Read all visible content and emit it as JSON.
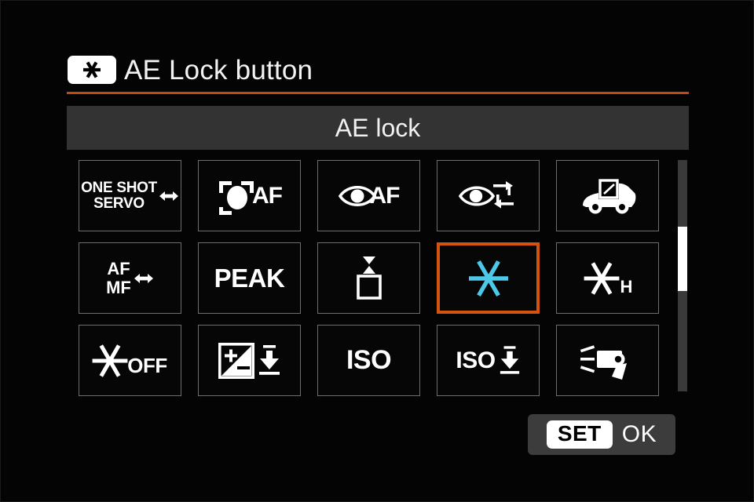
{
  "header": {
    "badge_icon": "ae-lock-asterisk-icon",
    "title": "AE Lock button"
  },
  "title_bar": {
    "current_function": "AE lock"
  },
  "grid": {
    "rows": 3,
    "columns": 5,
    "selected_index": 8,
    "selected_color": "#d4530f",
    "selected_icon_color": "#4dc8e8",
    "tiles": [
      {
        "name": "af-operation",
        "icon": "one-shot-servo-icon",
        "line1": "ONE SHOT",
        "line2": "SERVO",
        "selected": false
      },
      {
        "name": "subject-tracking-af",
        "icon": "subject-detect-af-icon",
        "label": "AF",
        "selected": false
      },
      {
        "name": "eye-detection-af",
        "icon": "eye-detect-af-icon",
        "label": "AF",
        "selected": false
      },
      {
        "name": "eye-detection-switch",
        "icon": "eye-switch-cycle-icon",
        "selected": false
      },
      {
        "name": "subject-to-detect-vehicle",
        "icon": "vehicle-detect-icon",
        "selected": false
      },
      {
        "name": "af-mf-switch",
        "icon": "af-mf-switch-icon",
        "line1": "AF",
        "line2": "MF",
        "selected": false
      },
      {
        "name": "focus-peaking",
        "icon": "peaking-text-icon",
        "label": "PEAK",
        "selected": false
      },
      {
        "name": "af-point-selection",
        "icon": "af-point-select-icon",
        "selected": false
      },
      {
        "name": "ae-lock",
        "icon": "ae-lock-asterisk-icon",
        "selected": true
      },
      {
        "name": "ae-lock-hold",
        "icon": "ae-lock-hold-icon",
        "label": "H",
        "selected": false
      },
      {
        "name": "ae-lock-off",
        "icon": "ae-lock-off-icon",
        "label": "OFF",
        "selected": false
      },
      {
        "name": "exposure-compensation",
        "icon": "exposure-comp-down-icon",
        "selected": false
      },
      {
        "name": "iso-speed",
        "icon": "iso-text-icon",
        "label": "ISO",
        "selected": false
      },
      {
        "name": "iso-speed-set",
        "icon": "iso-down-arrow-icon",
        "label": "ISO",
        "selected": false
      },
      {
        "name": "flash-function-settings",
        "icon": "speedlite-flash-icon",
        "selected": false
      }
    ]
  },
  "scrollbar": {
    "name": "vertical-scrollbar",
    "thumb_position_percent": 29
  },
  "footer": {
    "set_label": "SET",
    "ok_label": "OK"
  }
}
